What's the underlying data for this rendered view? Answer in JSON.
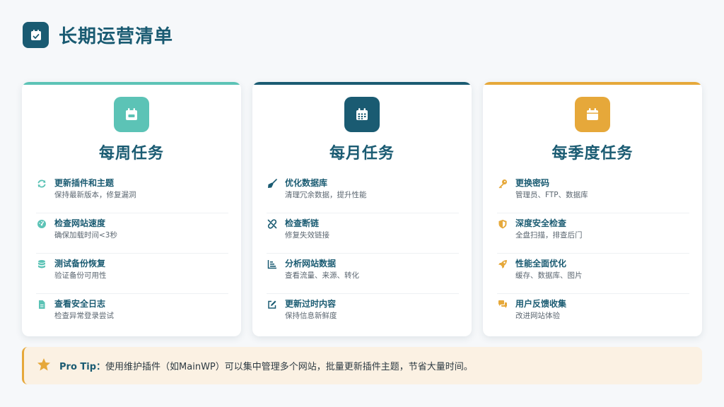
{
  "page": {
    "title": "长期运营清单",
    "header_icon": "calendar-check-icon"
  },
  "colors": {
    "weekly": "#5cc3b6",
    "monthly": "#1a5b72",
    "quarterly": "#e6a83a",
    "tip_bg": "#fbf1e3"
  },
  "cards": [
    {
      "title": "每周任务",
      "icon": "calendar-week-icon",
      "tasks": [
        {
          "title": "更新插件和主题",
          "desc": "保持最新版本，修复漏洞",
          "icon": "sync-icon"
        },
        {
          "title": "检查网站速度",
          "desc": "确保加载时间<3秒",
          "icon": "gauge-icon"
        },
        {
          "title": "测试备份恢复",
          "desc": "验证备份可用性",
          "icon": "database-icon"
        },
        {
          "title": "查看安全日志",
          "desc": "检查异常登录尝试",
          "icon": "file-icon"
        }
      ]
    },
    {
      "title": "每月任务",
      "icon": "calendar-days-icon",
      "tasks": [
        {
          "title": "优化数据库",
          "desc": "清理冗余数据，提升性能",
          "icon": "broom-icon"
        },
        {
          "title": "检查断链",
          "desc": "修复失效链接",
          "icon": "unlink-icon"
        },
        {
          "title": "分析网站数据",
          "desc": "查看流量、来源、转化",
          "icon": "bar-chart-icon"
        },
        {
          "title": "更新过时内容",
          "desc": "保持信息新鲜度",
          "icon": "edit-icon"
        }
      ]
    },
    {
      "title": "每季度任务",
      "icon": "calendar-icon",
      "tasks": [
        {
          "title": "更换密码",
          "desc": "管理员、FTP、数据库",
          "icon": "key-icon"
        },
        {
          "title": "深度安全检查",
          "desc": "全盘扫描，排查后门",
          "icon": "shield-icon"
        },
        {
          "title": "性能全面优化",
          "desc": "缓存、数据库、图片",
          "icon": "rocket-icon"
        },
        {
          "title": "用户反馈收集",
          "desc": "改进网站体验",
          "icon": "comments-icon"
        }
      ]
    }
  ],
  "tip": {
    "label": "Pro Tip：",
    "text": "使用维护插件（如MainWP）可以集中管理多个网站，批量更新插件主题，节省大量时间。",
    "icon": "star-icon"
  }
}
